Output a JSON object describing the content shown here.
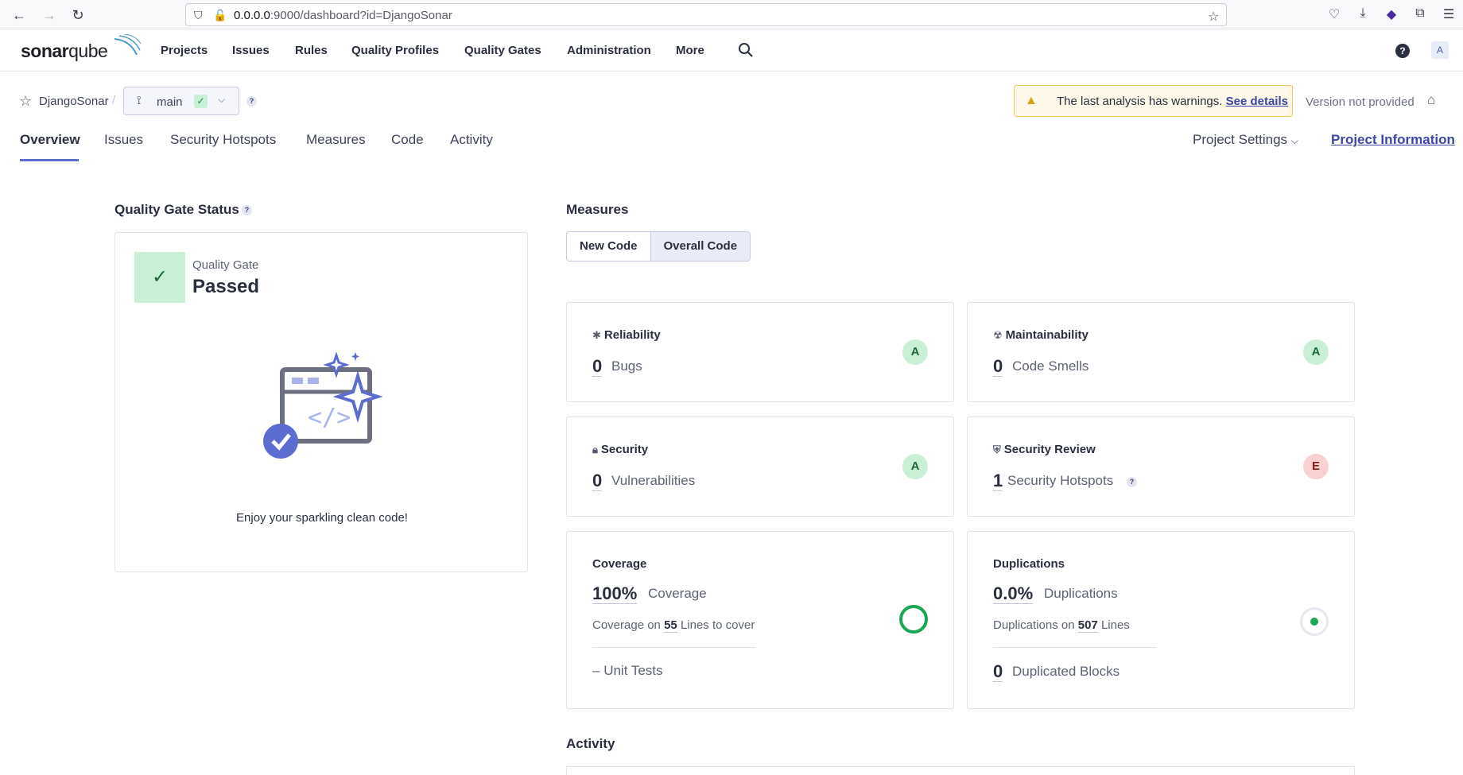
{
  "browser": {
    "url_host": "0.0.0.0",
    "url_rest": ":9000/dashboard?id=DjangoSonar"
  },
  "nav": {
    "logo_part1": "sonar",
    "logo_part2": "qube",
    "items": [
      "Projects",
      "Issues",
      "Rules",
      "Quality Profiles",
      "Quality Gates",
      "Administration",
      "More"
    ],
    "avatar": "A",
    "help": "?"
  },
  "project": {
    "name": "DjangoSonar",
    "branch": "main",
    "warning_text": "The last analysis has warnings.",
    "warning_link": "See details",
    "version": "Version not provided",
    "tabs": [
      "Overview",
      "Issues",
      "Security Hotspots",
      "Measures",
      "Code",
      "Activity"
    ],
    "settings": "Project Settings",
    "info": "Project Information"
  },
  "quality_gate": {
    "section_title": "Quality Gate Status",
    "label": "Quality Gate",
    "status": "Passed",
    "message": "Enjoy your sparkling clean code!",
    "status_color": "#c9f0d5"
  },
  "measures": {
    "section_title": "Measures",
    "toggle": [
      "New Code",
      "Overall Code"
    ],
    "selected_toggle": "Overall Code",
    "reliability": {
      "title": "Reliability",
      "value": "0",
      "label": "Bugs",
      "rating": "A"
    },
    "maintainability": {
      "title": "Maintainability",
      "value": "0",
      "label": "Code Smells",
      "rating": "A"
    },
    "security": {
      "title": "Security",
      "value": "0",
      "label": "Vulnerabilities",
      "rating": "A"
    },
    "security_review": {
      "title": "Security Review",
      "value": "1",
      "label": "Security Hotspots",
      "rating": "E"
    },
    "coverage": {
      "title": "Coverage",
      "value": "100%",
      "label": "Coverage",
      "sub_prefix": "Coverage on",
      "sub_value": "55",
      "sub_suffix": "Lines to cover",
      "unit_tests_value": "–",
      "unit_tests_label": "Unit Tests"
    },
    "duplications": {
      "title": "Duplications",
      "value": "0.0%",
      "label": "Duplications",
      "sub_prefix": "Duplications on",
      "sub_value": "507",
      "sub_suffix": "Lines",
      "blocks_value": "0",
      "blocks_label": "Duplicated Blocks"
    }
  },
  "activity": {
    "section_title": "Activity"
  }
}
